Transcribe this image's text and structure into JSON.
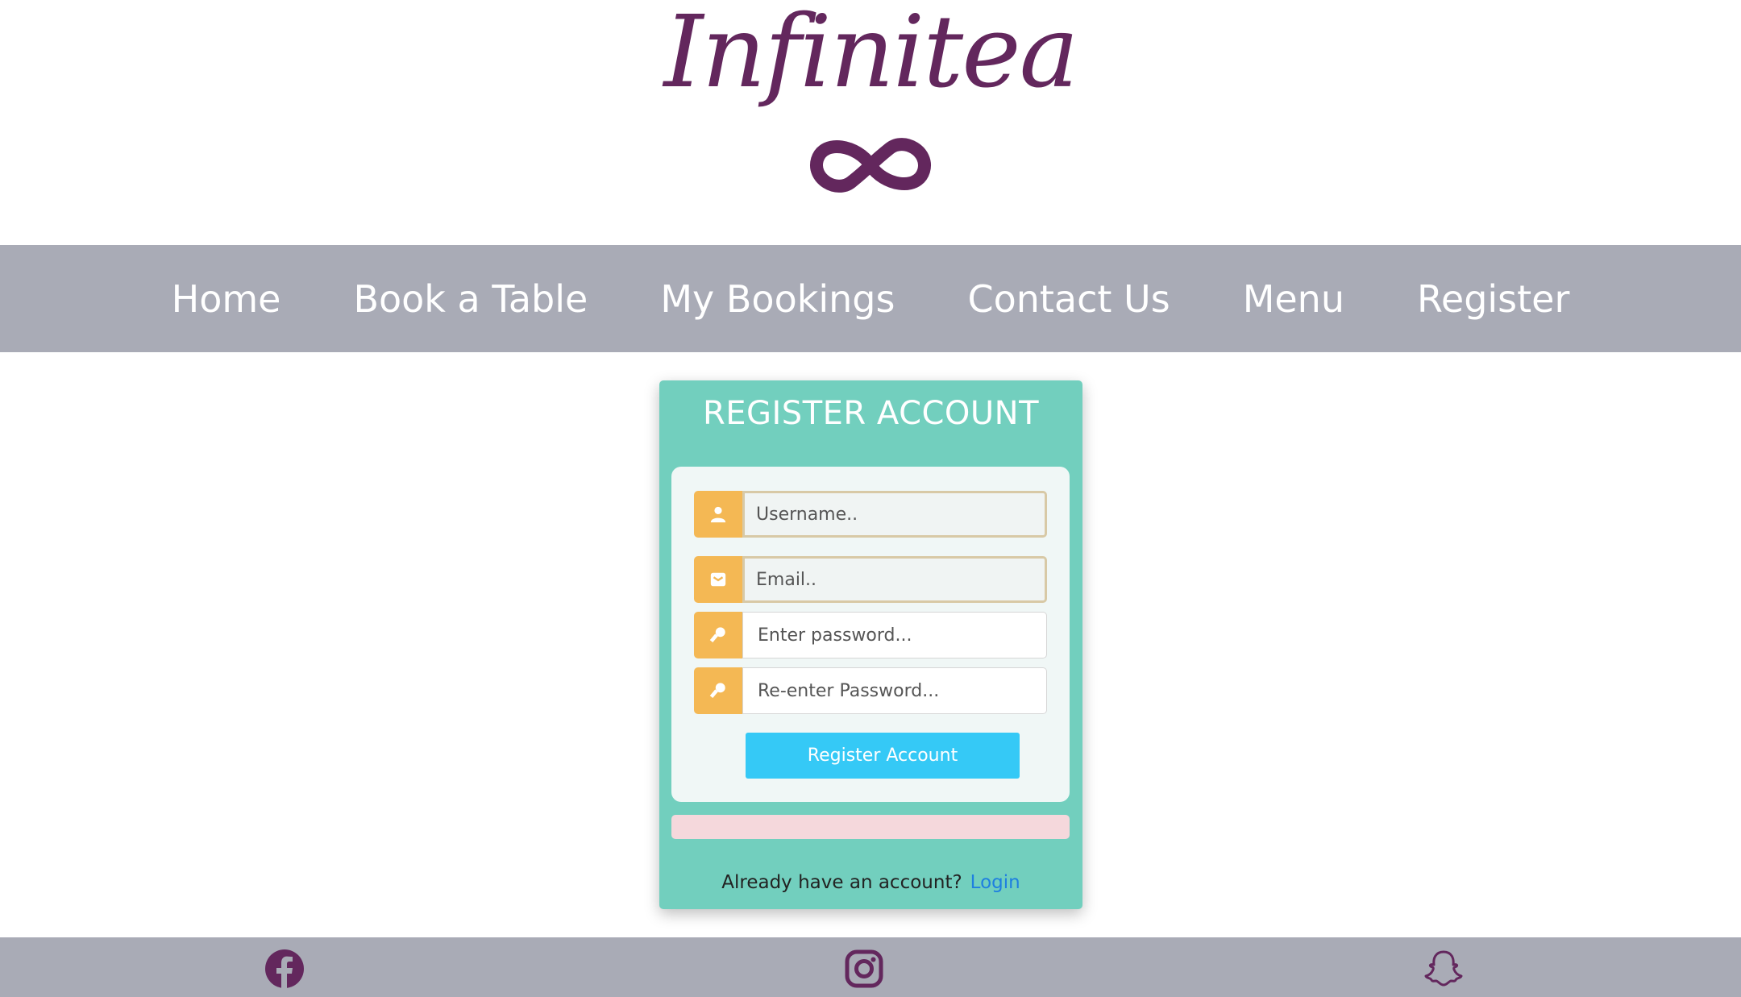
{
  "brand": {
    "name": "Infinitea",
    "logo_icon": "infinity-icon",
    "color": "#63275d"
  },
  "nav": {
    "items": [
      {
        "label": "Home"
      },
      {
        "label": "Book a Table"
      },
      {
        "label": "My Bookings"
      },
      {
        "label": "Contact Us"
      },
      {
        "label": "Menu"
      },
      {
        "label": "Register"
      }
    ]
  },
  "register": {
    "title": "REGISTER ACCOUNT",
    "fields": {
      "username": {
        "placeholder": "Username..",
        "value": "",
        "icon": "user-icon"
      },
      "email": {
        "placeholder": "Email..",
        "value": "",
        "icon": "envelope-icon"
      },
      "password": {
        "placeholder": "Enter password...",
        "value": "",
        "icon": "key-icon"
      },
      "confirm_password": {
        "placeholder": "Re-enter Password...",
        "value": "",
        "icon": "key-icon"
      }
    },
    "submit_label": "Register Account",
    "login_prompt": "Already have an account?",
    "login_link": "Login"
  },
  "footer": {
    "social": [
      "facebook-icon",
      "instagram-icon",
      "snapchat-icon"
    ]
  },
  "colors": {
    "nav_bg": "#a9abb6",
    "card_bg": "#72cfbe",
    "addon": "#f4b854",
    "button": "#35c9f6",
    "link": "#1e7fe0",
    "alert": "#f5d8dc"
  }
}
